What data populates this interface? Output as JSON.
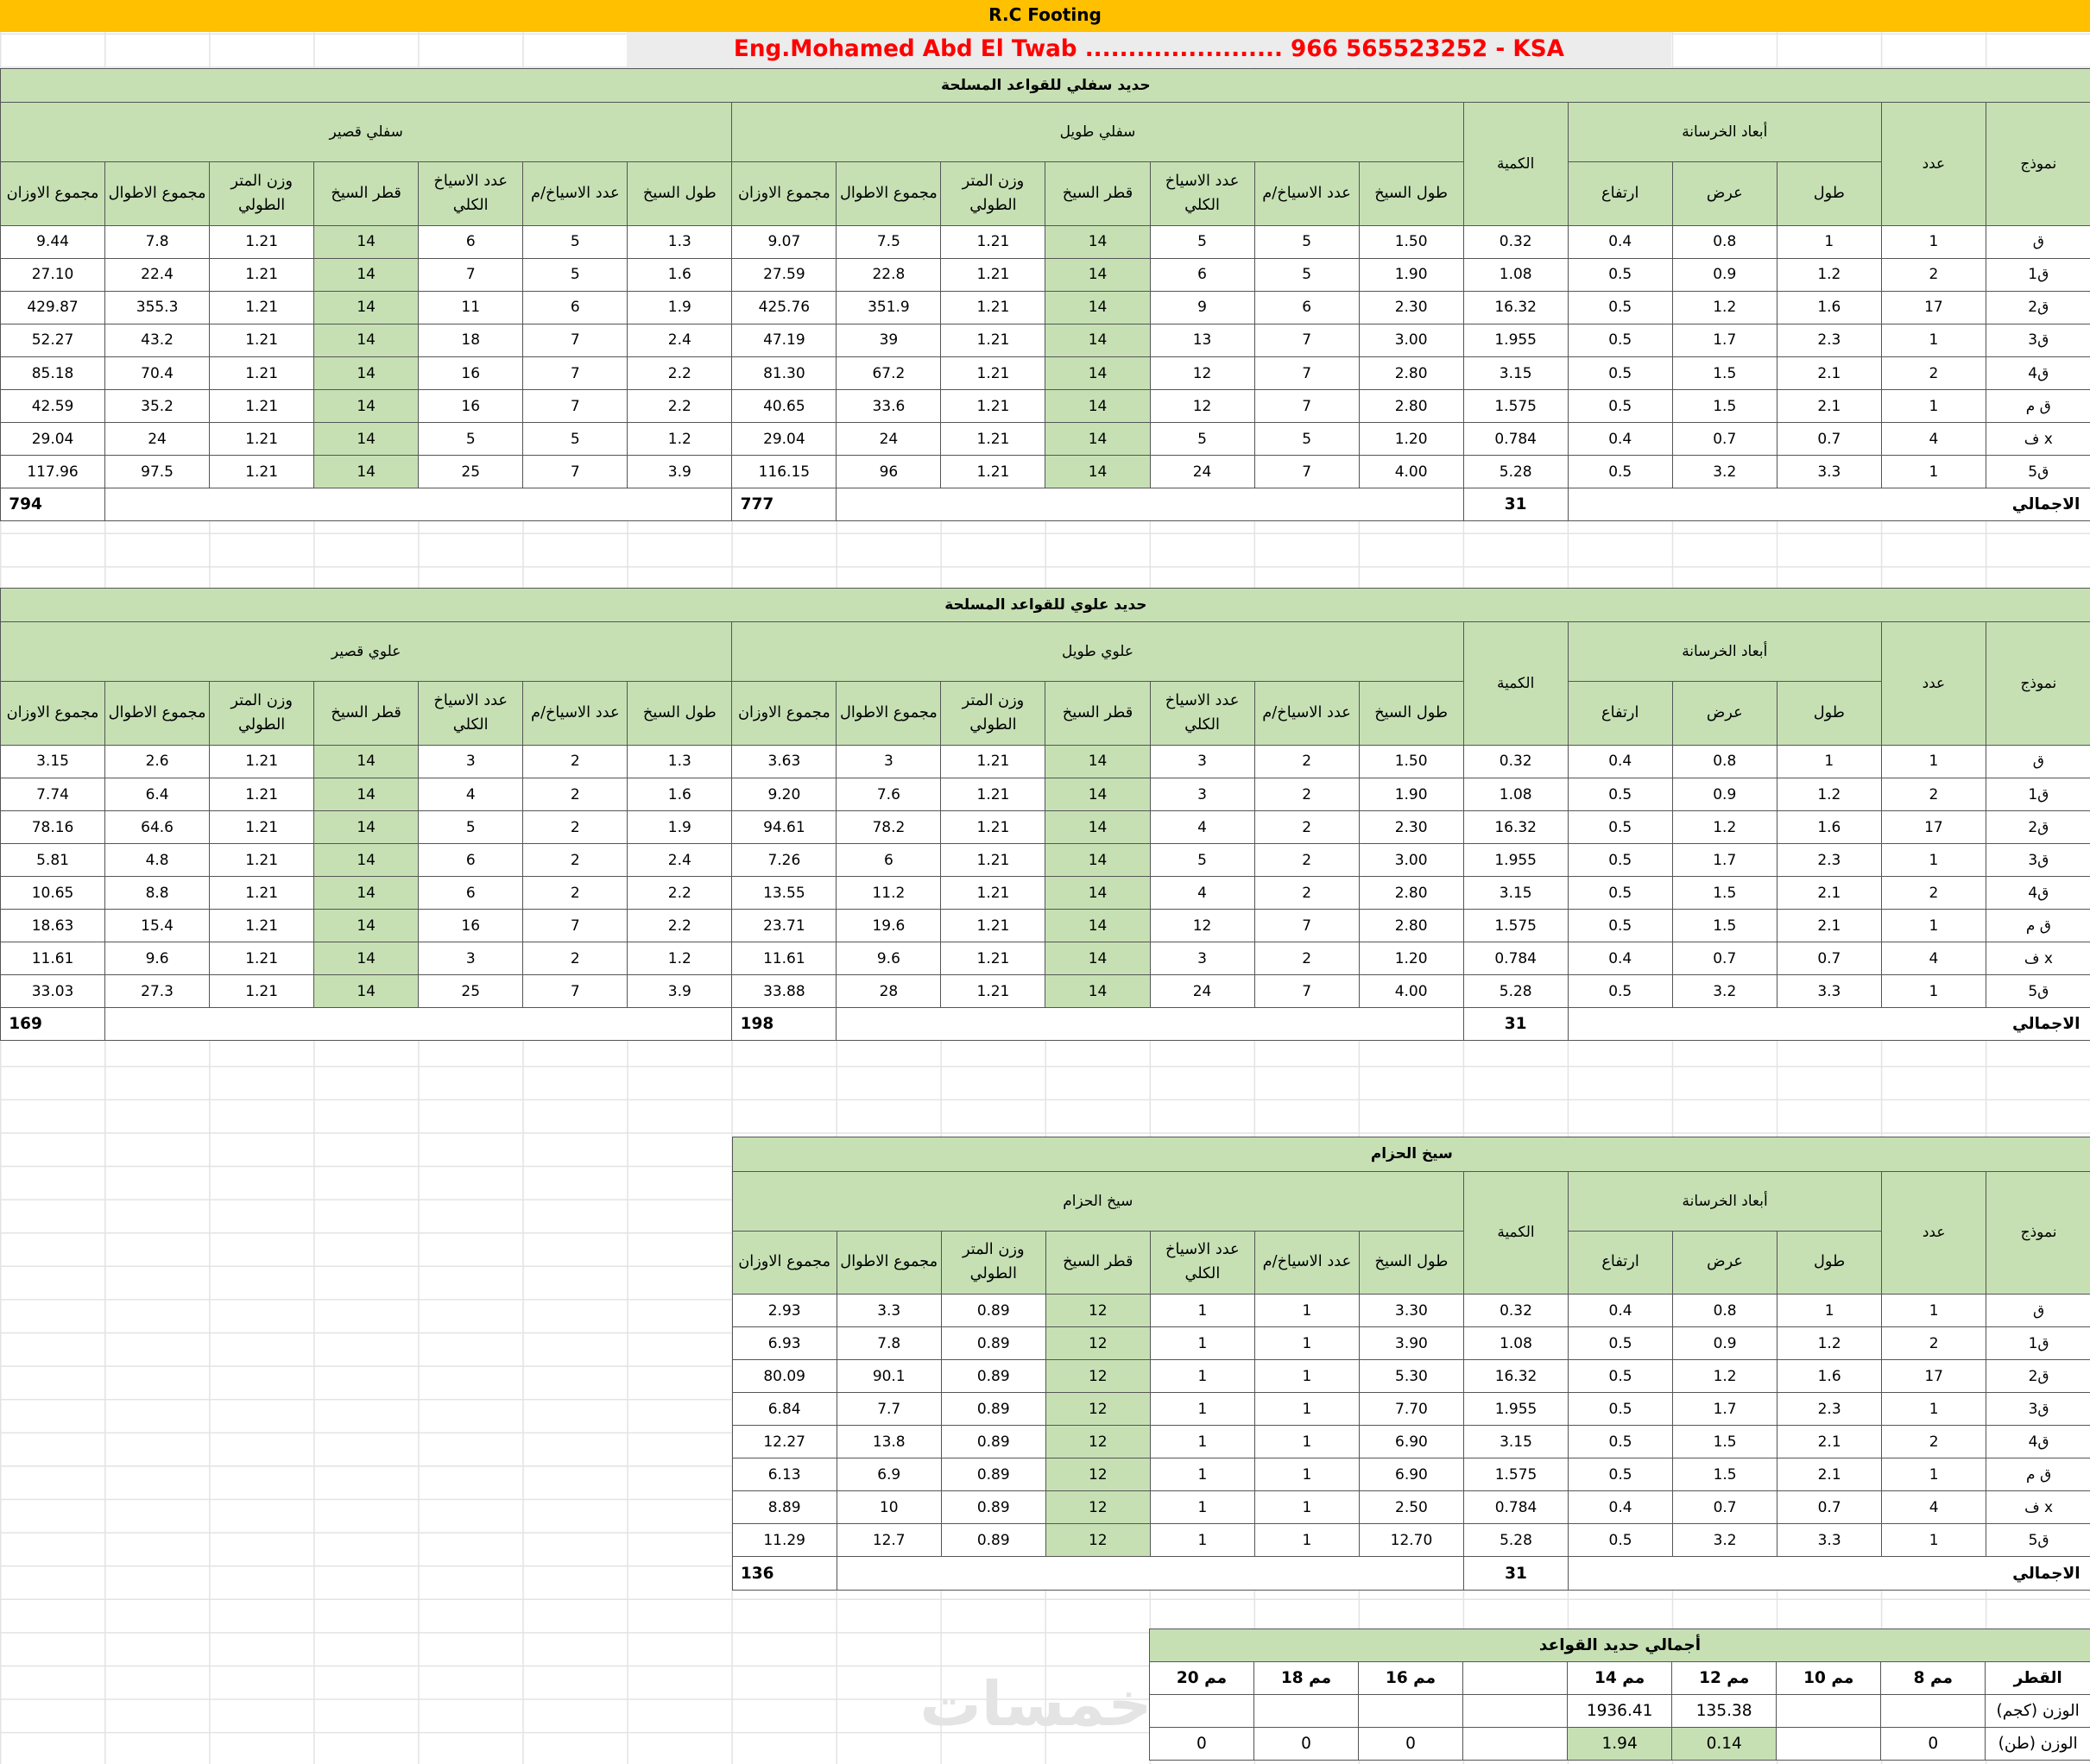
{
  "title": "R.C Footing",
  "engineer_line": "Eng.Mohamed Abd El Twab .......................  966 565523252 - KSA",
  "headers": {
    "model": "نموذج",
    "count": "عدد",
    "concrete_dims": "أبعاد الخرسانة",
    "length": "طول",
    "width": "عرض",
    "height": "ارتفاع",
    "quantity": "الكمية",
    "bar_length": "طول السيخ",
    "bars_per_m": "عدد الاسياخ/م",
    "total_bars": "عدد الاسياخ الكلي",
    "bar_dia": "قطر السيخ",
    "weight_per_m": "وزن المتر الطولي",
    "sum_lengths": "مجموع الاطوال",
    "sum_weights": "مجموع الاوزان",
    "total": "الاجمالي"
  },
  "concrete_rows": [
    {
      "model": "ق",
      "count": "1",
      "l": "1",
      "w": "0.8",
      "h": "0.4",
      "qty": "0.32"
    },
    {
      "model": "ق1",
      "count": "2",
      "l": "1.2",
      "w": "0.9",
      "h": "0.5",
      "qty": "1.08"
    },
    {
      "model": "ق2",
      "count": "17",
      "l": "1.6",
      "w": "1.2",
      "h": "0.5",
      "qty": "16.32"
    },
    {
      "model": "ق3",
      "count": "1",
      "l": "2.3",
      "w": "1.7",
      "h": "0.5",
      "qty": "1.955"
    },
    {
      "model": "ق4",
      "count": "2",
      "l": "2.1",
      "w": "1.5",
      "h": "0.5",
      "qty": "3.15"
    },
    {
      "model": "ق م",
      "count": "1",
      "l": "2.1",
      "w": "1.5",
      "h": "0.5",
      "qty": "1.575"
    },
    {
      "model": "ف x",
      "count": "4",
      "l": "0.7",
      "w": "0.7",
      "h": "0.4",
      "qty": "0.784"
    },
    {
      "model": "ق5",
      "count": "1",
      "l": "3.3",
      "w": "3.2",
      "h": "0.5",
      "qty": "5.28"
    }
  ],
  "concrete_total": "31",
  "bottom": {
    "title": "حديد سفلي للقواعد المسلحة",
    "long_label": "سفلي طويل",
    "short_label": "سفلي قصير",
    "long_rows": [
      [
        "1.50",
        "5",
        "5",
        "14",
        "1.21",
        "7.5",
        "9.07"
      ],
      [
        "1.90",
        "5",
        "6",
        "14",
        "1.21",
        "22.8",
        "27.59"
      ],
      [
        "2.30",
        "6",
        "9",
        "14",
        "1.21",
        "351.9",
        "425.76"
      ],
      [
        "3.00",
        "7",
        "13",
        "14",
        "1.21",
        "39",
        "47.19"
      ],
      [
        "2.80",
        "7",
        "12",
        "14",
        "1.21",
        "67.2",
        "81.30"
      ],
      [
        "2.80",
        "7",
        "12",
        "14",
        "1.21",
        "33.6",
        "40.65"
      ],
      [
        "1.20",
        "5",
        "5",
        "14",
        "1.21",
        "24",
        "29.04"
      ],
      [
        "4.00",
        "7",
        "24",
        "14",
        "1.21",
        "96",
        "116.15"
      ]
    ],
    "short_rows": [
      [
        "1.3",
        "5",
        "6",
        "14",
        "1.21",
        "7.8",
        "9.44"
      ],
      [
        "1.6",
        "5",
        "7",
        "14",
        "1.21",
        "22.4",
        "27.10"
      ],
      [
        "1.9",
        "6",
        "11",
        "14",
        "1.21",
        "355.3",
        "429.87"
      ],
      [
        "2.4",
        "7",
        "18",
        "14",
        "1.21",
        "43.2",
        "52.27"
      ],
      [
        "2.2",
        "7",
        "16",
        "14",
        "1.21",
        "70.4",
        "85.18"
      ],
      [
        "2.2",
        "7",
        "16",
        "14",
        "1.21",
        "35.2",
        "42.59"
      ],
      [
        "1.2",
        "5",
        "5",
        "14",
        "1.21",
        "24",
        "29.04"
      ],
      [
        "3.9",
        "7",
        "25",
        "14",
        "1.21",
        "97.5",
        "117.96"
      ]
    ],
    "long_total": "777",
    "short_total": "794"
  },
  "top": {
    "title": "حديد علوي للقواعد المسلحة",
    "long_label": "علوي طويل",
    "short_label": "علوي قصير",
    "long_rows": [
      [
        "1.50",
        "2",
        "3",
        "14",
        "1.21",
        "3",
        "3.63"
      ],
      [
        "1.90",
        "2",
        "3",
        "14",
        "1.21",
        "7.6",
        "9.20"
      ],
      [
        "2.30",
        "2",
        "4",
        "14",
        "1.21",
        "78.2",
        "94.61"
      ],
      [
        "3.00",
        "2",
        "5",
        "14",
        "1.21",
        "6",
        "7.26"
      ],
      [
        "2.80",
        "2",
        "4",
        "14",
        "1.21",
        "11.2",
        "13.55"
      ],
      [
        "2.80",
        "7",
        "12",
        "14",
        "1.21",
        "19.6",
        "23.71"
      ],
      [
        "1.20",
        "2",
        "3",
        "14",
        "1.21",
        "9.6",
        "11.61"
      ],
      [
        "4.00",
        "7",
        "24",
        "14",
        "1.21",
        "28",
        "33.88"
      ]
    ],
    "short_rows": [
      [
        "1.3",
        "2",
        "3",
        "14",
        "1.21",
        "2.6",
        "3.15"
      ],
      [
        "1.6",
        "2",
        "4",
        "14",
        "1.21",
        "6.4",
        "7.74"
      ],
      [
        "1.9",
        "2",
        "5",
        "14",
        "1.21",
        "64.6",
        "78.16"
      ],
      [
        "2.4",
        "2",
        "6",
        "14",
        "1.21",
        "4.8",
        "5.81"
      ],
      [
        "2.2",
        "2",
        "6",
        "14",
        "1.21",
        "8.8",
        "10.65"
      ],
      [
        "2.2",
        "7",
        "16",
        "14",
        "1.21",
        "15.4",
        "18.63"
      ],
      [
        "1.2",
        "2",
        "3",
        "14",
        "1.21",
        "9.6",
        "11.61"
      ],
      [
        "3.9",
        "7",
        "25",
        "14",
        "1.21",
        "27.3",
        "33.03"
      ]
    ],
    "long_total": "198",
    "short_total": "169"
  },
  "belt": {
    "title": "سيخ الحزام",
    "label": "سيخ الحزام",
    "rows": [
      [
        "3.30",
        "1",
        "1",
        "12",
        "0.89",
        "3.3",
        "2.93"
      ],
      [
        "3.90",
        "1",
        "1",
        "12",
        "0.89",
        "7.8",
        "6.93"
      ],
      [
        "5.30",
        "1",
        "1",
        "12",
        "0.89",
        "90.1",
        "80.09"
      ],
      [
        "7.70",
        "1",
        "1",
        "12",
        "0.89",
        "7.7",
        "6.84"
      ],
      [
        "6.90",
        "1",
        "1",
        "12",
        "0.89",
        "13.8",
        "12.27"
      ],
      [
        "6.90",
        "1",
        "1",
        "12",
        "0.89",
        "6.9",
        "6.13"
      ],
      [
        "2.50",
        "1",
        "1",
        "12",
        "0.89",
        "10",
        "8.89"
      ],
      [
        "12.70",
        "1",
        "1",
        "12",
        "0.89",
        "12.7",
        "11.29"
      ]
    ],
    "total": "136"
  },
  "summary": {
    "title": "أجمالي حديد القواعد",
    "dia_label": "القطر",
    "diameters": [
      "8 مم",
      "10 مم",
      "12 مم",
      "14 مم",
      "",
      "16 مم",
      "18 مم",
      "20 مم"
    ],
    "kg_label": "الوزن (كجم)",
    "kg": [
      "",
      "",
      "135.38",
      "1936.41",
      "",
      "",
      "",
      ""
    ],
    "ton_label": "الوزن (طن)",
    "ton": [
      "0",
      "",
      "0.14",
      "1.94",
      "",
      "0",
      "0",
      "0"
    ]
  },
  "watermark": "خمسات"
}
